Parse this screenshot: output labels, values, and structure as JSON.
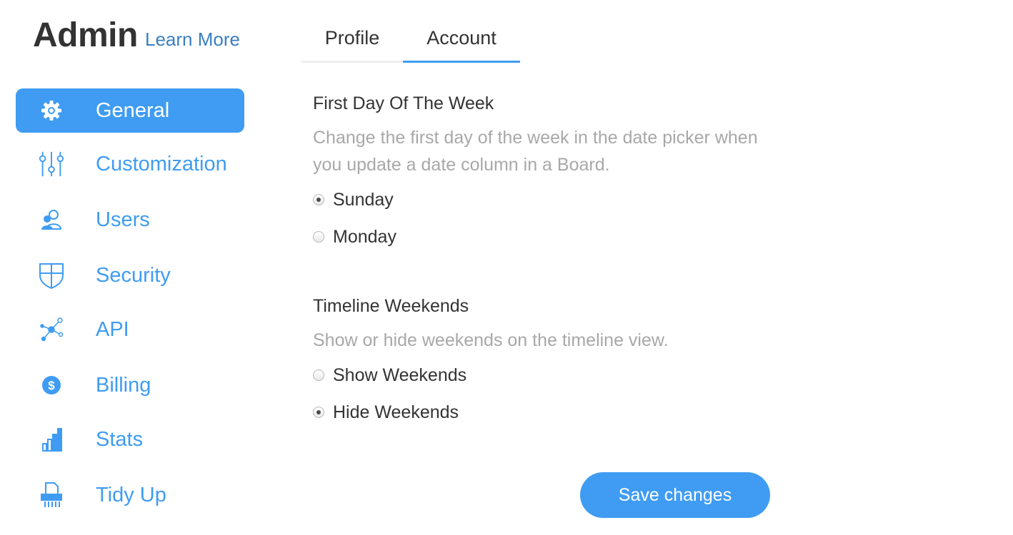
{
  "header": {
    "title": "Admin",
    "learn_more": "Learn More"
  },
  "sidebar": {
    "items": [
      {
        "label": "General",
        "icon": "gear-icon",
        "active": true
      },
      {
        "label": "Customization",
        "icon": "sliders-icon"
      },
      {
        "label": "Users",
        "icon": "users-icon"
      },
      {
        "label": "Security",
        "icon": "shield-icon"
      },
      {
        "label": "API",
        "icon": "network-icon"
      },
      {
        "label": "Billing",
        "icon": "dollar-icon"
      },
      {
        "label": "Stats",
        "icon": "bar-chart-icon"
      },
      {
        "label": "Tidy Up",
        "icon": "shredder-icon"
      }
    ]
  },
  "tabs": [
    {
      "label": "Profile"
    },
    {
      "label": "Account",
      "active": true
    }
  ],
  "first_day": {
    "title": "First Day Of The Week",
    "description": "Change the first day of the week in the date picker when you update a date column in a Board.",
    "options": [
      {
        "label": "Sunday",
        "checked": true
      },
      {
        "label": "Monday",
        "checked": false
      }
    ]
  },
  "timeline_weekends": {
    "title": "Timeline Weekends",
    "description": "Show or hide weekends on the timeline view.",
    "options": [
      {
        "label": "Show Weekends",
        "checked": false
      },
      {
        "label": "Hide Weekends",
        "checked": true
      }
    ]
  },
  "save_button": {
    "label": "Save changes"
  },
  "colors": {
    "accent": "#3f9cf2",
    "link": "#3a7fc1",
    "muted_text": "#a8a8a8",
    "text": "#333333"
  }
}
